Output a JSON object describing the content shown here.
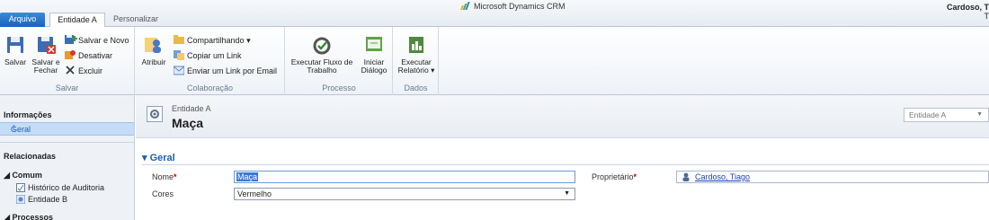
{
  "topbar": {
    "tabs": {
      "file": "Arquivo",
      "entity": "Entidade A",
      "customize": "Personalizar"
    },
    "brand": "Microsoft Dynamics CRM",
    "user_name": "Cardoso, T",
    "user_line2": "T"
  },
  "ribbon": {
    "save_group": {
      "label": "Salvar",
      "save": "Salvar",
      "save_close_1": "Salvar e",
      "save_close_2": "Fechar",
      "save_new": "Salvar e Novo",
      "deactivate": "Desativar",
      "delete": "Excluir"
    },
    "collab_group": {
      "label": "Colaboração",
      "assign": "Atribuir",
      "share": "Compartilhando",
      "copy_link": "Copiar um Link",
      "email_link": "Enviar um Link por Email"
    },
    "process_group": {
      "label": "Processo",
      "run_workflow_1": "Executar Fluxo de",
      "run_workflow_2": "Trabalho",
      "start_dialog_1": "Iniciar",
      "start_dialog_2": "Diálogo"
    },
    "data_group": {
      "label": "Dados",
      "run_report_1": "Executar",
      "run_report_2": "Relatório"
    }
  },
  "leftnav": {
    "info_title": "Informações",
    "general": "Geral",
    "related_title": "Relacionadas",
    "common_title": "Comum",
    "audit_history": "Histórico de Auditoria",
    "entity_b": "Entidade B",
    "processes_title": "Processos"
  },
  "main": {
    "entity_type": "Entidade A",
    "record_title": "Maça",
    "form_selector": "Entidade A",
    "section_title": "Geral",
    "name_label": "Nome",
    "name_value": "Maça",
    "colors_label": "Cores",
    "colors_value": "Vermelho",
    "owner_label": "Proprietário",
    "owner_value": "Cardoso, Tiago"
  },
  "colors": {
    "accent": "#1c5fb5",
    "required": "#cc0000",
    "link": "#1c3fb0"
  }
}
